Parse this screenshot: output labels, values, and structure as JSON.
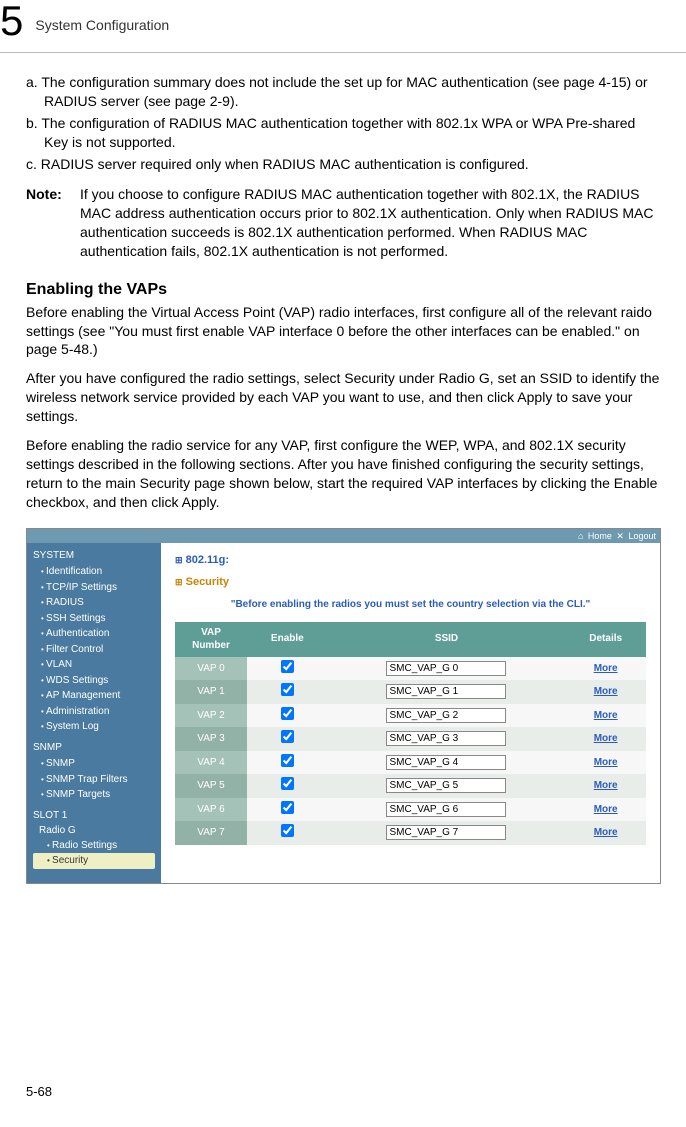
{
  "header": {
    "chapter_num": "5",
    "chapter_title": "System Configuration"
  },
  "page_num": "5-68",
  "list": {
    "a": "a. The configuration summary does not include the set up for MAC authentication (see page 4-15) or RADIUS server (see page 2-9).",
    "b": "b. The configuration of RADIUS MAC authentication together with 802.1x WPA or WPA Pre-shared Key is not supported.",
    "c": "c. RADIUS server required only when RADIUS MAC authentication is configured."
  },
  "note": {
    "label": "Note:",
    "text": "If you choose to configure RADIUS MAC authentication together with 802.1X, the RADIUS MAC address authentication occurs prior to 802.1X authentication. Only when RADIUS MAC authentication succeeds is 802.1X authentication performed. When RADIUS MAC authentication fails, 802.1X authentication is not performed."
  },
  "heading": "Enabling the VAPs",
  "p1": "Before enabling the Virtual Access Point (VAP) radio interfaces, first configure all of the relevant raido settings (see \"You must first enable VAP interface 0 before the other interfaces can be enabled.\" on page 5-48.)",
  "p2": "After you have configured the radio settings, select Security under Radio G, set an SSID to identify the wireless network service provided by each VAP you want to use, and then click Apply to save your settings.",
  "p3": "Before enabling the radio service for any VAP, first configure the WEP, WPA, and 802.1X security settings described in the following sections. After you have finished configuring the security settings, return to the main Security page shown below, start the required VAP interfaces by clicking the Enable checkbox, and then click Apply.",
  "shot": {
    "topbar_home": "Home",
    "topbar_logout": "Logout",
    "sidebar": {
      "system": "SYSTEM",
      "items_sys": [
        "Identification",
        "TCP/IP Settings",
        "RADIUS",
        "SSH Settings",
        "Authentication",
        "Filter Control",
        "VLAN",
        "WDS Settings",
        "AP Management",
        "Administration",
        "System Log"
      ],
      "snmp": "SNMP",
      "items_snmp": [
        "SNMP",
        "SNMP Trap Filters",
        "SNMP Targets"
      ],
      "slot": "SLOT 1",
      "slot_sub": "Radio G",
      "items_slot": [
        "Radio Settings",
        "Security"
      ]
    },
    "main": {
      "radio_band": "802.11g:",
      "sec_label": "Security",
      "warning": "\"Before enabling the radios you must set the country selection via the CLI.\"",
      "th_vap": "VAP Number",
      "th_enable": "Enable",
      "th_ssid": "SSID",
      "th_details": "Details",
      "more": "More",
      "rows": [
        {
          "vap": "VAP 0",
          "ssid": "SMC_VAP_G 0"
        },
        {
          "vap": "VAP 1",
          "ssid": "SMC_VAP_G 1"
        },
        {
          "vap": "VAP 2",
          "ssid": "SMC_VAP_G 2"
        },
        {
          "vap": "VAP 3",
          "ssid": "SMC_VAP_G 3"
        },
        {
          "vap": "VAP 4",
          "ssid": "SMC_VAP_G 4"
        },
        {
          "vap": "VAP 5",
          "ssid": "SMC_VAP_G 5"
        },
        {
          "vap": "VAP 6",
          "ssid": "SMC_VAP_G 6"
        },
        {
          "vap": "VAP 7",
          "ssid": "SMC_VAP_G 7"
        }
      ]
    }
  }
}
